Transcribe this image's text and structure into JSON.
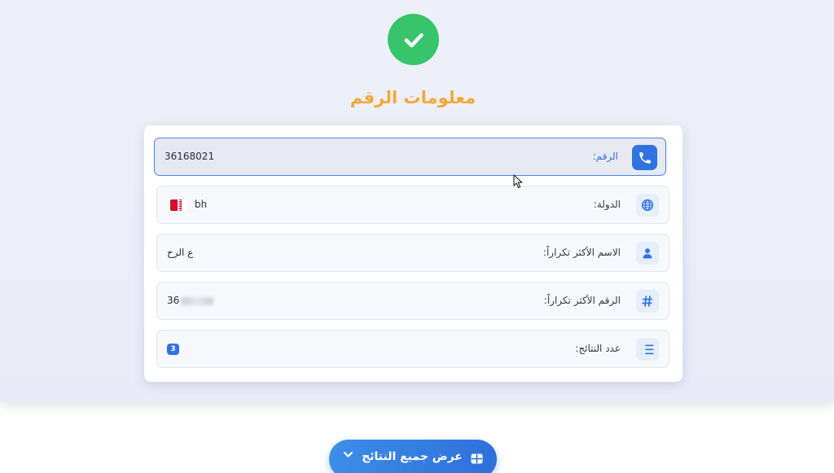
{
  "header": {
    "title": "معلومات الرقم",
    "status_icon": "check-circle-icon",
    "status_color": "#37c46a"
  },
  "rows": [
    {
      "label": "الرقم:",
      "value": "36168021",
      "icon": "phone-icon"
    },
    {
      "label": "الدولة:",
      "value": "bh",
      "icon": "globe-icon",
      "flag": "bahrain-flag"
    },
    {
      "label": "الاسم الأكثر تكراراً:",
      "value": "ع الرح",
      "icon": "user-icon"
    },
    {
      "label": "الرقم الأكثر تكراراً:",
      "value": "36",
      "icon": "hash-icon",
      "value_blurred": true
    },
    {
      "label": "عدد النتائج:",
      "value": "3",
      "icon": "list-icon"
    }
  ],
  "actions": {
    "show_all_label": "عرض جميع النتائج",
    "show_all_icon": "table-icon",
    "chevron_icon": "chevron-down-icon"
  },
  "colors": {
    "accent": "#2f73e0",
    "title": "#f2a93b",
    "success": "#37c46a"
  }
}
